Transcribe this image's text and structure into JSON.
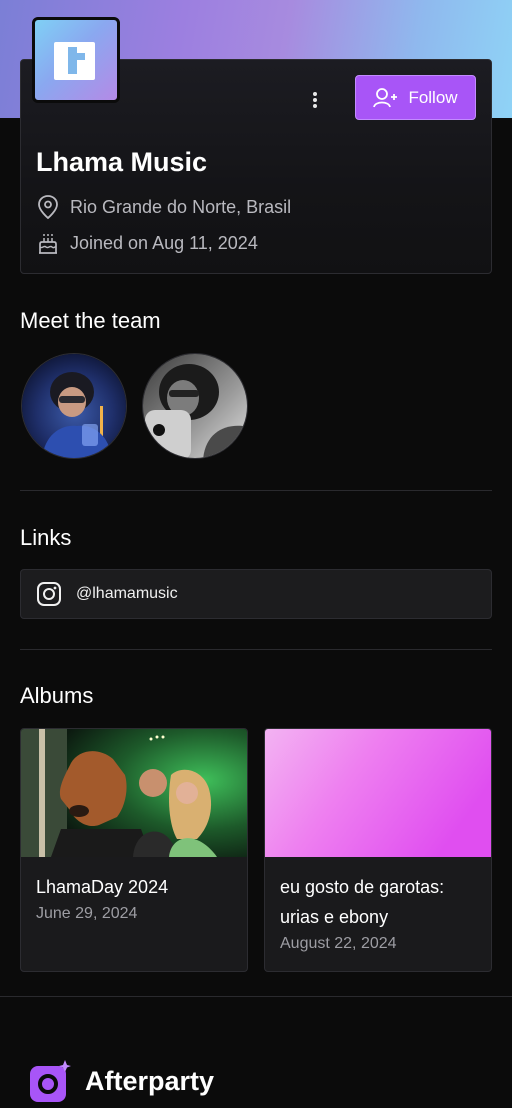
{
  "profile": {
    "name": "Lhama Music",
    "location": "Rio Grande do Norte, Brasil",
    "joined": "Joined on Aug 11, 2024",
    "follow_label": "Follow",
    "more_icon": "more-vertical-icon"
  },
  "team": {
    "title": "Meet the team",
    "members": [
      "member-1",
      "member-2"
    ]
  },
  "links": {
    "title": "Links",
    "items": [
      {
        "icon": "instagram-icon",
        "handle": "@lhamamusic"
      }
    ]
  },
  "albums": {
    "title": "Albums",
    "items": [
      {
        "title": "LhamaDay 2024",
        "date": "June 29, 2024"
      },
      {
        "title": "eu gosto de garotas: urias e ebony",
        "date": "August 22, 2024"
      }
    ]
  },
  "footer": {
    "brand": "Afterparty"
  },
  "colors": {
    "accent": "#a855f7",
    "background": "#0b0b0b",
    "card": "#1a1a1c"
  }
}
